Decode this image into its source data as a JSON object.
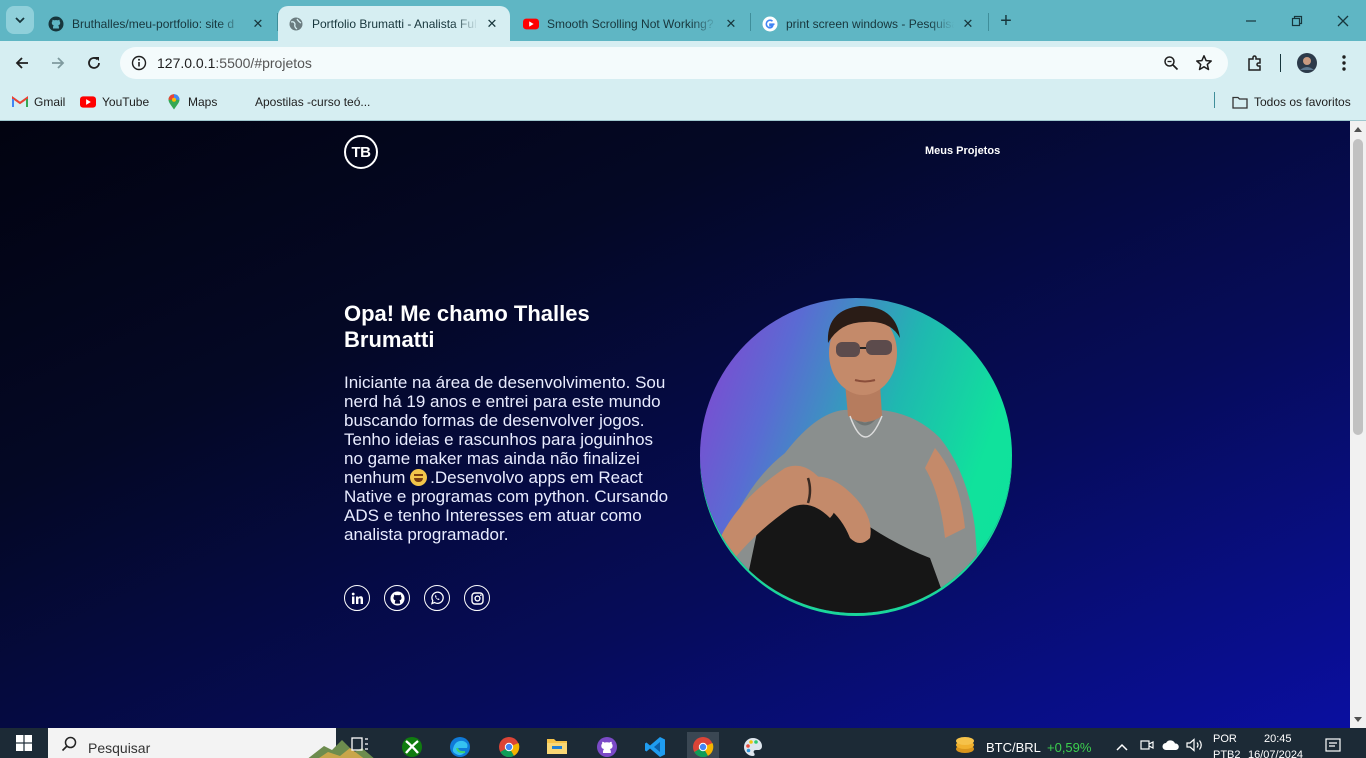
{
  "browser": {
    "tabs": [
      {
        "title": "Bruthalles/meu-portfolio: site d",
        "icon": "github-icon",
        "active": false
      },
      {
        "title": "Portfolio Brumatti - Analista Ful",
        "icon": "globe-icon",
        "active": true
      },
      {
        "title": "Smooth Scrolling Not Working?",
        "icon": "youtube-icon",
        "active": false
      },
      {
        "title": "print screen windows - Pesquisa",
        "icon": "google-icon",
        "active": false
      }
    ],
    "url_host": "127.0.0.1",
    "url_rest": ":5500/#projetos",
    "bookmarks": [
      {
        "label": "Gmail",
        "icon": "gmail-icon"
      },
      {
        "label": "YouTube",
        "icon": "youtube-icon"
      },
      {
        "label": "Maps",
        "icon": "maps-icon"
      },
      {
        "label": "Apostilas -curso teó...",
        "icon": ""
      }
    ],
    "all_bookmarks_label": "Todos os favoritos"
  },
  "page": {
    "logo_text": "TB",
    "nav_link": "Meus Projetos",
    "title": "Opa! Me chamo Thalles Brumatti",
    "intro_before_emoji": "Iniciante na área de desenvolvimento. Sou nerd há 19 anos e entrei para este mundo buscando formas de desenvolver jogos. Tenho ideias e rascunhos para joguinhos no game maker mas ainda não finalizei nenhum",
    "intro_after_emoji": ".Desenvolvo apps em React Native e programas com python. Cursando ADS e tenho Interesses em atuar como analista programador.",
    "emoji": "grinning-sweat-emoji",
    "socials": [
      "linkedin-icon",
      "github-icon",
      "whatsapp-icon",
      "instagram-icon"
    ],
    "colors": {
      "background_top": "#020310",
      "background_bottom": "#0a0fa0",
      "photo_gradient_left": "#8a3fd0",
      "photo_gradient_right": "#0ee39b"
    }
  },
  "taskbar": {
    "search_placeholder": "Pesquisar",
    "ticker_label": "BTC/BRL",
    "ticker_change": "+0,59%",
    "ticker_change_color": "#3ccf4e",
    "lang_top": "POR",
    "lang_bottom": "PTB2",
    "time": "20:45",
    "date": "16/07/2024"
  }
}
